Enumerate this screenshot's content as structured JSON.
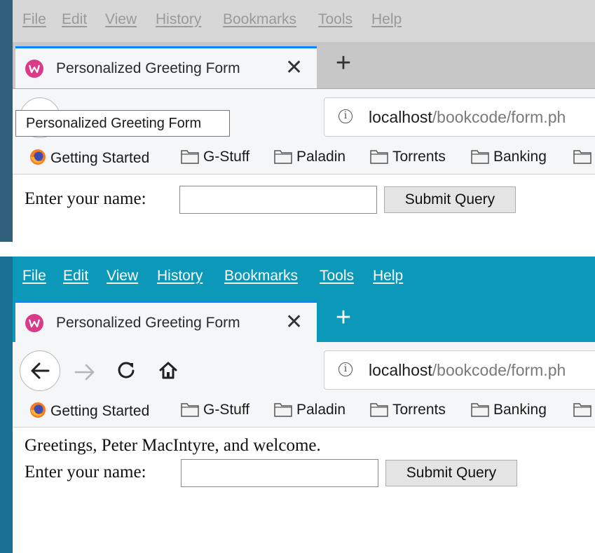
{
  "menu": [
    "File",
    "Edit",
    "View",
    "History",
    "Bookmarks",
    "Tools",
    "Help"
  ],
  "tab": {
    "title": "Personalized Greeting Form",
    "close_glyph": "✕",
    "new_tab_glyph": "+"
  },
  "tooltip": "Personalized Greeting Form",
  "url": {
    "host": "localhost",
    "path": "/bookcode/form.ph"
  },
  "bookmarks": [
    "Getting Started",
    "G-Stuff",
    "Paladin",
    "Torrents",
    "Banking"
  ],
  "form": {
    "label": "Enter your name:",
    "input_value": "",
    "submit_label": "Submit Query"
  },
  "result": {
    "greeting": "Greetings, Peter MacIntyre, and welcome."
  },
  "colors": {
    "menubar_inactive": "#d7d7d7",
    "menubar_active": "#0b98b9",
    "tab_accent": "#0a84ff"
  }
}
